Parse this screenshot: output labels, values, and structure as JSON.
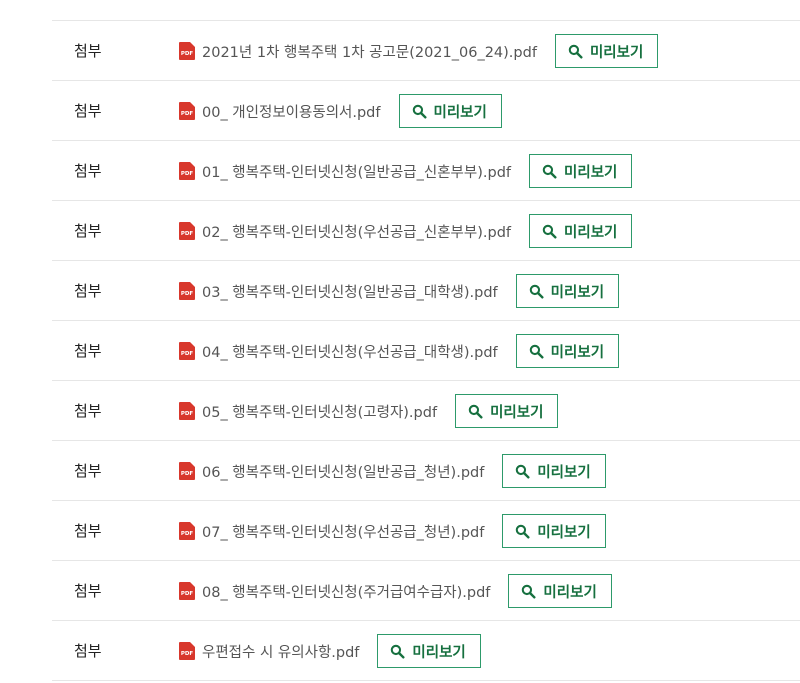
{
  "attachments": [
    {
      "label": "첨부",
      "file_name": "2021년 1차 행복주택 1차 공고문(2021_06_24).pdf",
      "icon": "pdf-file-icon",
      "preview_label": "미리보기"
    },
    {
      "label": "첨부",
      "file_name": "00_ 개인정보이용동의서.pdf",
      "icon": "pdf-file-icon",
      "preview_label": "미리보기"
    },
    {
      "label": "첨부",
      "file_name": "01_ 행복주택-인터넷신청(일반공급_신혼부부).pdf",
      "icon": "pdf-file-icon",
      "preview_label": "미리보기"
    },
    {
      "label": "첨부",
      "file_name": "02_ 행복주택-인터넷신청(우선공급_신혼부부).pdf",
      "icon": "pdf-file-icon",
      "preview_label": "미리보기"
    },
    {
      "label": "첨부",
      "file_name": "03_ 행복주택-인터넷신청(일반공급_대학생).pdf",
      "icon": "pdf-file-icon",
      "preview_label": "미리보기"
    },
    {
      "label": "첨부",
      "file_name": "04_ 행복주택-인터넷신청(우선공급_대학생).pdf",
      "icon": "pdf-file-icon",
      "preview_label": "미리보기"
    },
    {
      "label": "첨부",
      "file_name": "05_ 행복주택-인터넷신청(고령자).pdf",
      "icon": "pdf-file-icon",
      "preview_label": "미리보기"
    },
    {
      "label": "첨부",
      "file_name": "06_ 행복주택-인터넷신청(일반공급_청년).pdf",
      "icon": "pdf-file-icon",
      "preview_label": "미리보기"
    },
    {
      "label": "첨부",
      "file_name": "07_ 행복주택-인터넷신청(우선공급_청년).pdf",
      "icon": "pdf-file-icon",
      "preview_label": "미리보기"
    },
    {
      "label": "첨부",
      "file_name": "08_ 행복주택-인터넷신청(주거급여수급자).pdf",
      "icon": "pdf-file-icon",
      "preview_label": "미리보기"
    },
    {
      "label": "첨부",
      "file_name": "우편접수 시 유의사항.pdf",
      "icon": "pdf-file-icon",
      "preview_label": "미리보기"
    }
  ],
  "pdf_icon_text": "PDF",
  "preview_icon": "search-icon",
  "colors": {
    "accent_border": "#2d9a6a",
    "accent_text": "#16703f",
    "pdf_red": "#d8372c",
    "row_divider": "#e6e6e6"
  }
}
